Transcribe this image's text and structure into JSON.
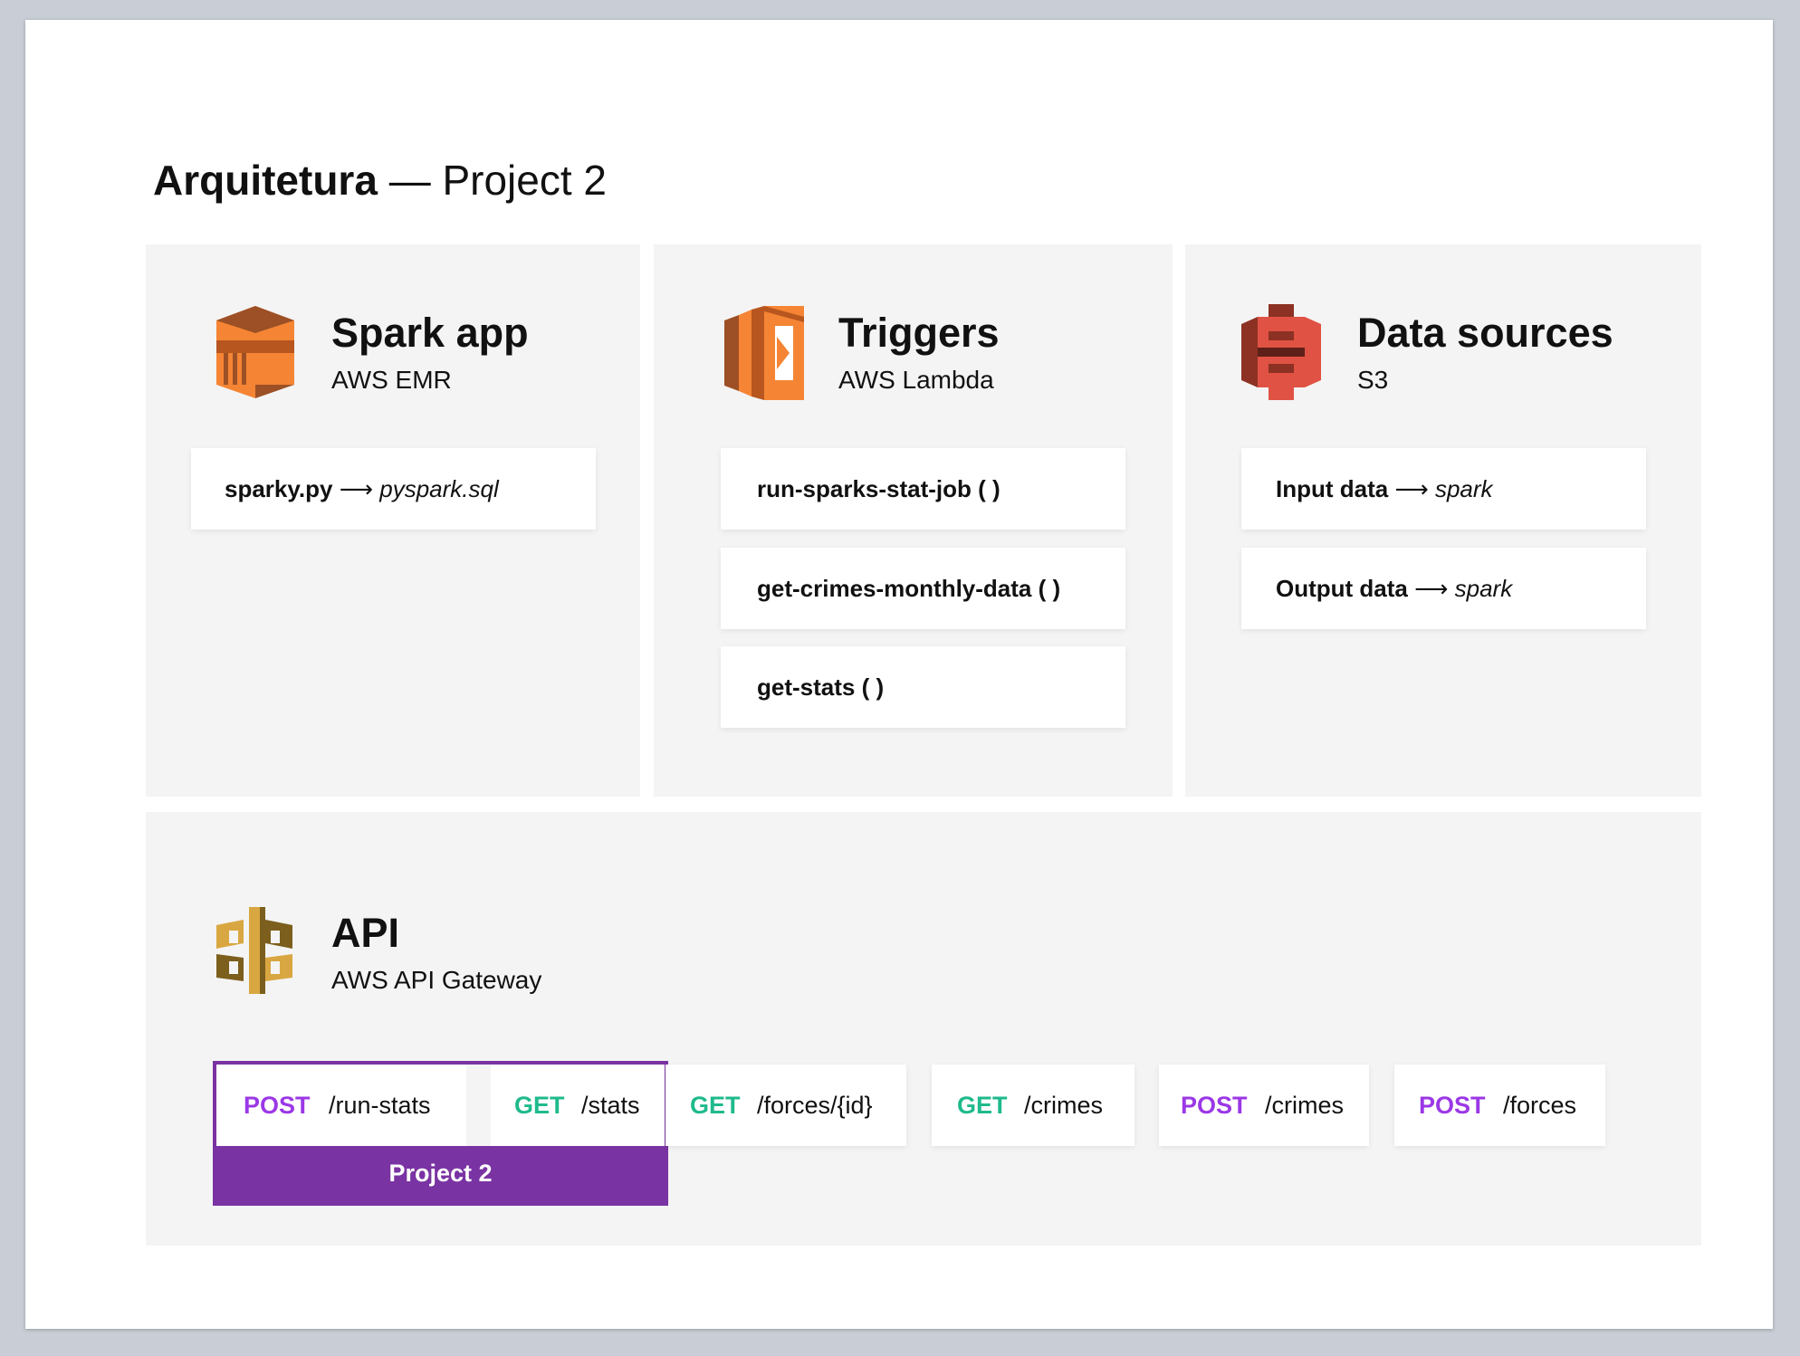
{
  "title": {
    "bold": "Arquitetura",
    "rest": "— Project 2"
  },
  "panels": {
    "spark": {
      "heading": "Spark app",
      "subtitle": "AWS EMR",
      "icon": "aws-emr-icon",
      "items": [
        {
          "name": "sparky.py",
          "arrow": "⟶",
          "target": "pyspark.sql"
        }
      ]
    },
    "triggers": {
      "heading": "Triggers",
      "subtitle": "AWS Lambda",
      "icon": "aws-lambda-icon",
      "items": [
        {
          "label": "run-sparks-stat-job ( )"
        },
        {
          "label": "get-crimes-monthly-data ( )"
        },
        {
          "label": "get-stats ( )"
        }
      ]
    },
    "data": {
      "heading": "Data sources",
      "subtitle": "S3",
      "icon": "aws-s3-icon",
      "items": [
        {
          "name": "Input data",
          "arrow": "⟶",
          "target": "spark"
        },
        {
          "name": "Output data",
          "arrow": "⟶",
          "target": "spark"
        }
      ]
    },
    "api": {
      "heading": "API",
      "subtitle": "AWS API Gateway",
      "icon": "aws-api-gateway-icon",
      "project_label": "Project 2",
      "endpoints": [
        {
          "method": "POST",
          "path": "/run-stats"
        },
        {
          "method": "GET",
          "path": "/stats"
        },
        {
          "method": "GET",
          "path": "/forces/{id}"
        },
        {
          "method": "GET",
          "path": "/crimes"
        },
        {
          "method": "POST",
          "path": "/crimes"
        },
        {
          "method": "POST",
          "path": "/forces"
        }
      ]
    }
  },
  "colors": {
    "emr": "#f58534",
    "lambda": "#f58534",
    "s3": "#e05243",
    "api_gateway": "#d9a741",
    "post": "#9b38e6",
    "get": "#1fba8c",
    "project": "#7a33a2"
  }
}
